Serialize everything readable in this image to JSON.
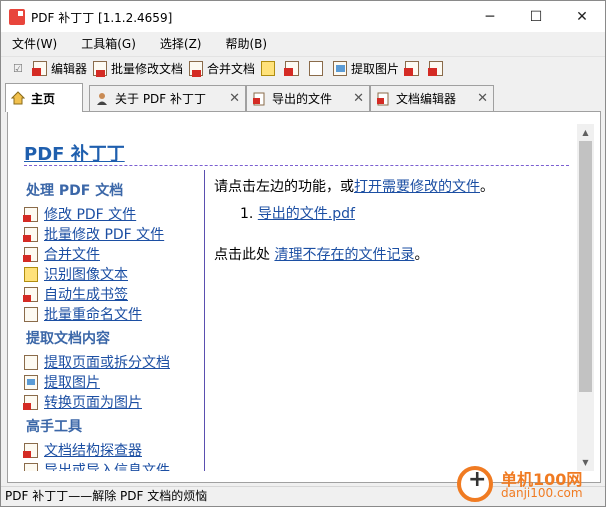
{
  "window": {
    "title": "PDF 补丁丁 [1.1.2.4659]",
    "min_glyph": "─",
    "max_glyph": "☐",
    "close_glyph": "✕"
  },
  "menu": [
    "文件(W)",
    "工具箱(G)",
    "选择(Z)",
    "帮助(B)"
  ],
  "toolbar": {
    "items": [
      {
        "label": "编辑器",
        "icon": "pdf-edit-icon"
      },
      {
        "label": "批量修改文档",
        "icon": "batch-modify-icon"
      },
      {
        "label": "合并文档",
        "icon": "merge-icon"
      },
      {
        "label": "",
        "icon": "ocr-icon"
      },
      {
        "label": "",
        "icon": "bookmark-icon"
      },
      {
        "label": "",
        "icon": "rename-icon"
      },
      {
        "label": "提取图片",
        "icon": "extract-image-icon"
      },
      {
        "label": "",
        "icon": "convert-icon"
      },
      {
        "label": "",
        "icon": "export-icon"
      }
    ]
  },
  "tabs": [
    {
      "label": "主页",
      "closable": false
    },
    {
      "label": "关于 PDF 补丁丁",
      "closable": true
    },
    {
      "label": "导出的文件",
      "closable": true
    },
    {
      "label": "文档编辑器",
      "closable": true
    }
  ],
  "home": {
    "title": "PDF 补丁丁",
    "sections": [
      {
        "heading": "处理 PDF 文档",
        "links": [
          {
            "label": "修改 PDF 文件",
            "icon": "pdf-edit-icon"
          },
          {
            "label": "批量修改 PDF 文件",
            "icon": "batch-modify-icon"
          },
          {
            "label": "合并文件",
            "icon": "merge-icon"
          },
          {
            "label": "识别图像文本",
            "icon": "ocr-icon"
          },
          {
            "label": "自动生成书签",
            "icon": "bookmark-icon"
          },
          {
            "label": "批量重命名文件",
            "icon": "rename-icon"
          }
        ]
      },
      {
        "heading": "提取文档内容",
        "links": [
          {
            "label": "提取页面或拆分文档",
            "icon": "extract-pages-icon"
          },
          {
            "label": "提取图片",
            "icon": "extract-image-icon"
          },
          {
            "label": "转换页面为图片",
            "icon": "convert-icon"
          }
        ]
      },
      {
        "heading": "高手工具",
        "links": [
          {
            "label": "文档结构探查器",
            "icon": "inspector-icon"
          },
          {
            "label": "导出或导入信息文件",
            "icon": "export-icon"
          }
        ]
      }
    ],
    "intro_prefix": "请点击左边的功能，或",
    "intro_link": "打开需要修改的文件",
    "intro_suffix": "。",
    "recent_number": "1.",
    "recent_file": "导出的文件.pdf",
    "cleanup_prefix": "点击此处 ",
    "cleanup_link": "清理不存在的文件记录",
    "cleanup_suffix": "。"
  },
  "status": "PDF 补丁丁——解除 PDF 文档的烦恼",
  "watermark": {
    "title": "单机100网",
    "url": "danji100.com"
  },
  "colors": {
    "link": "#1c4fa3",
    "heading": "#3b67a8",
    "title": "#1f5fae",
    "accent": "#f07b22"
  }
}
